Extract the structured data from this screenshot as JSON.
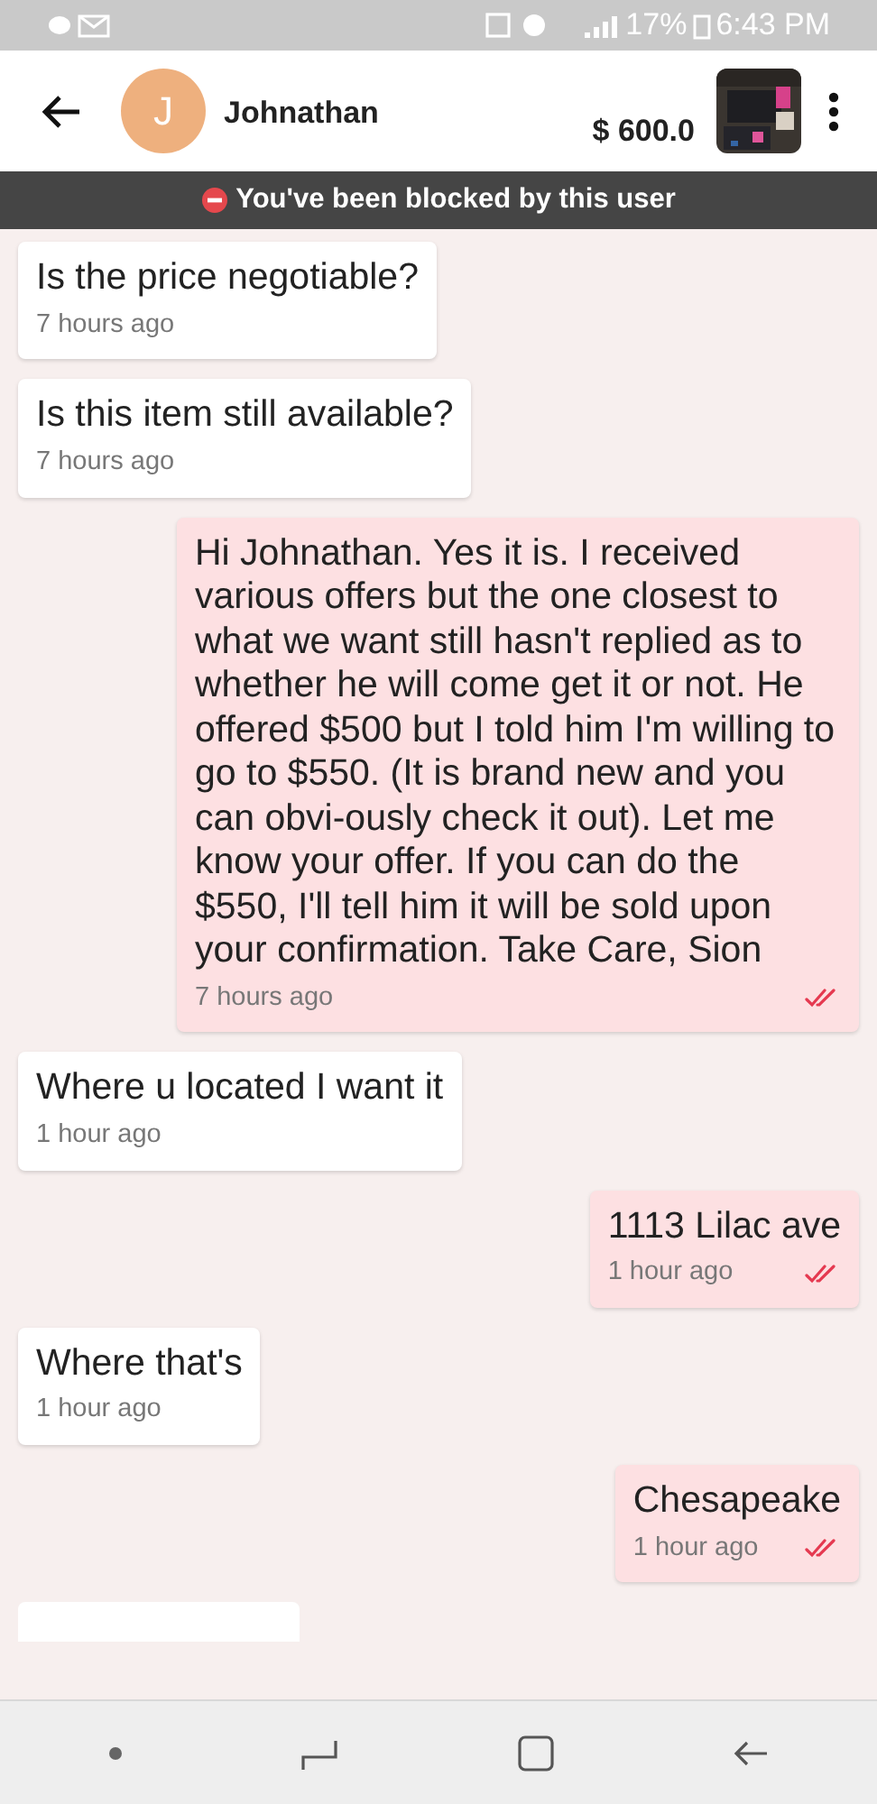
{
  "status_bar": {
    "battery": "17%",
    "time": "6:43 PM"
  },
  "header": {
    "contact": {
      "initial": "J",
      "name": "Johnathan"
    },
    "price": "$ 600.0"
  },
  "banner": {
    "text": "You've been blocked by this user"
  },
  "messages": [
    {
      "kind": "incoming",
      "text": "Is the price negotiable?",
      "time": "7 hours ago"
    },
    {
      "kind": "incoming",
      "text": "Is this item still available?",
      "time": "7 hours ago"
    },
    {
      "kind": "outgoing",
      "text": "Hi Johnathan. Yes it is. I received various offers but the one closest to what we want still hasn't replied as to whether he will come get it or not. He offered $500 but I told him I'm willing to go to $550. (It is brand new and you can obvi-ously check it out). Let me know your offer. If you can do the $550, I'll tell him it will be sold upon your confirmation. Take Care, Sion",
      "time": "7 hours ago",
      "read": true
    },
    {
      "kind": "incoming",
      "text": "Where u located I want it",
      "time": "1 hour ago"
    },
    {
      "kind": "outgoing",
      "text": "1113 Lilac ave",
      "time": "1 hour ago",
      "read": true
    },
    {
      "kind": "incoming",
      "text": "Where that's",
      "time": "1 hour ago"
    },
    {
      "kind": "outgoing",
      "text": "Chesapeake",
      "time": "1 hour ago",
      "read": true
    },
    {
      "kind": "incoming-cutoff"
    }
  ]
}
